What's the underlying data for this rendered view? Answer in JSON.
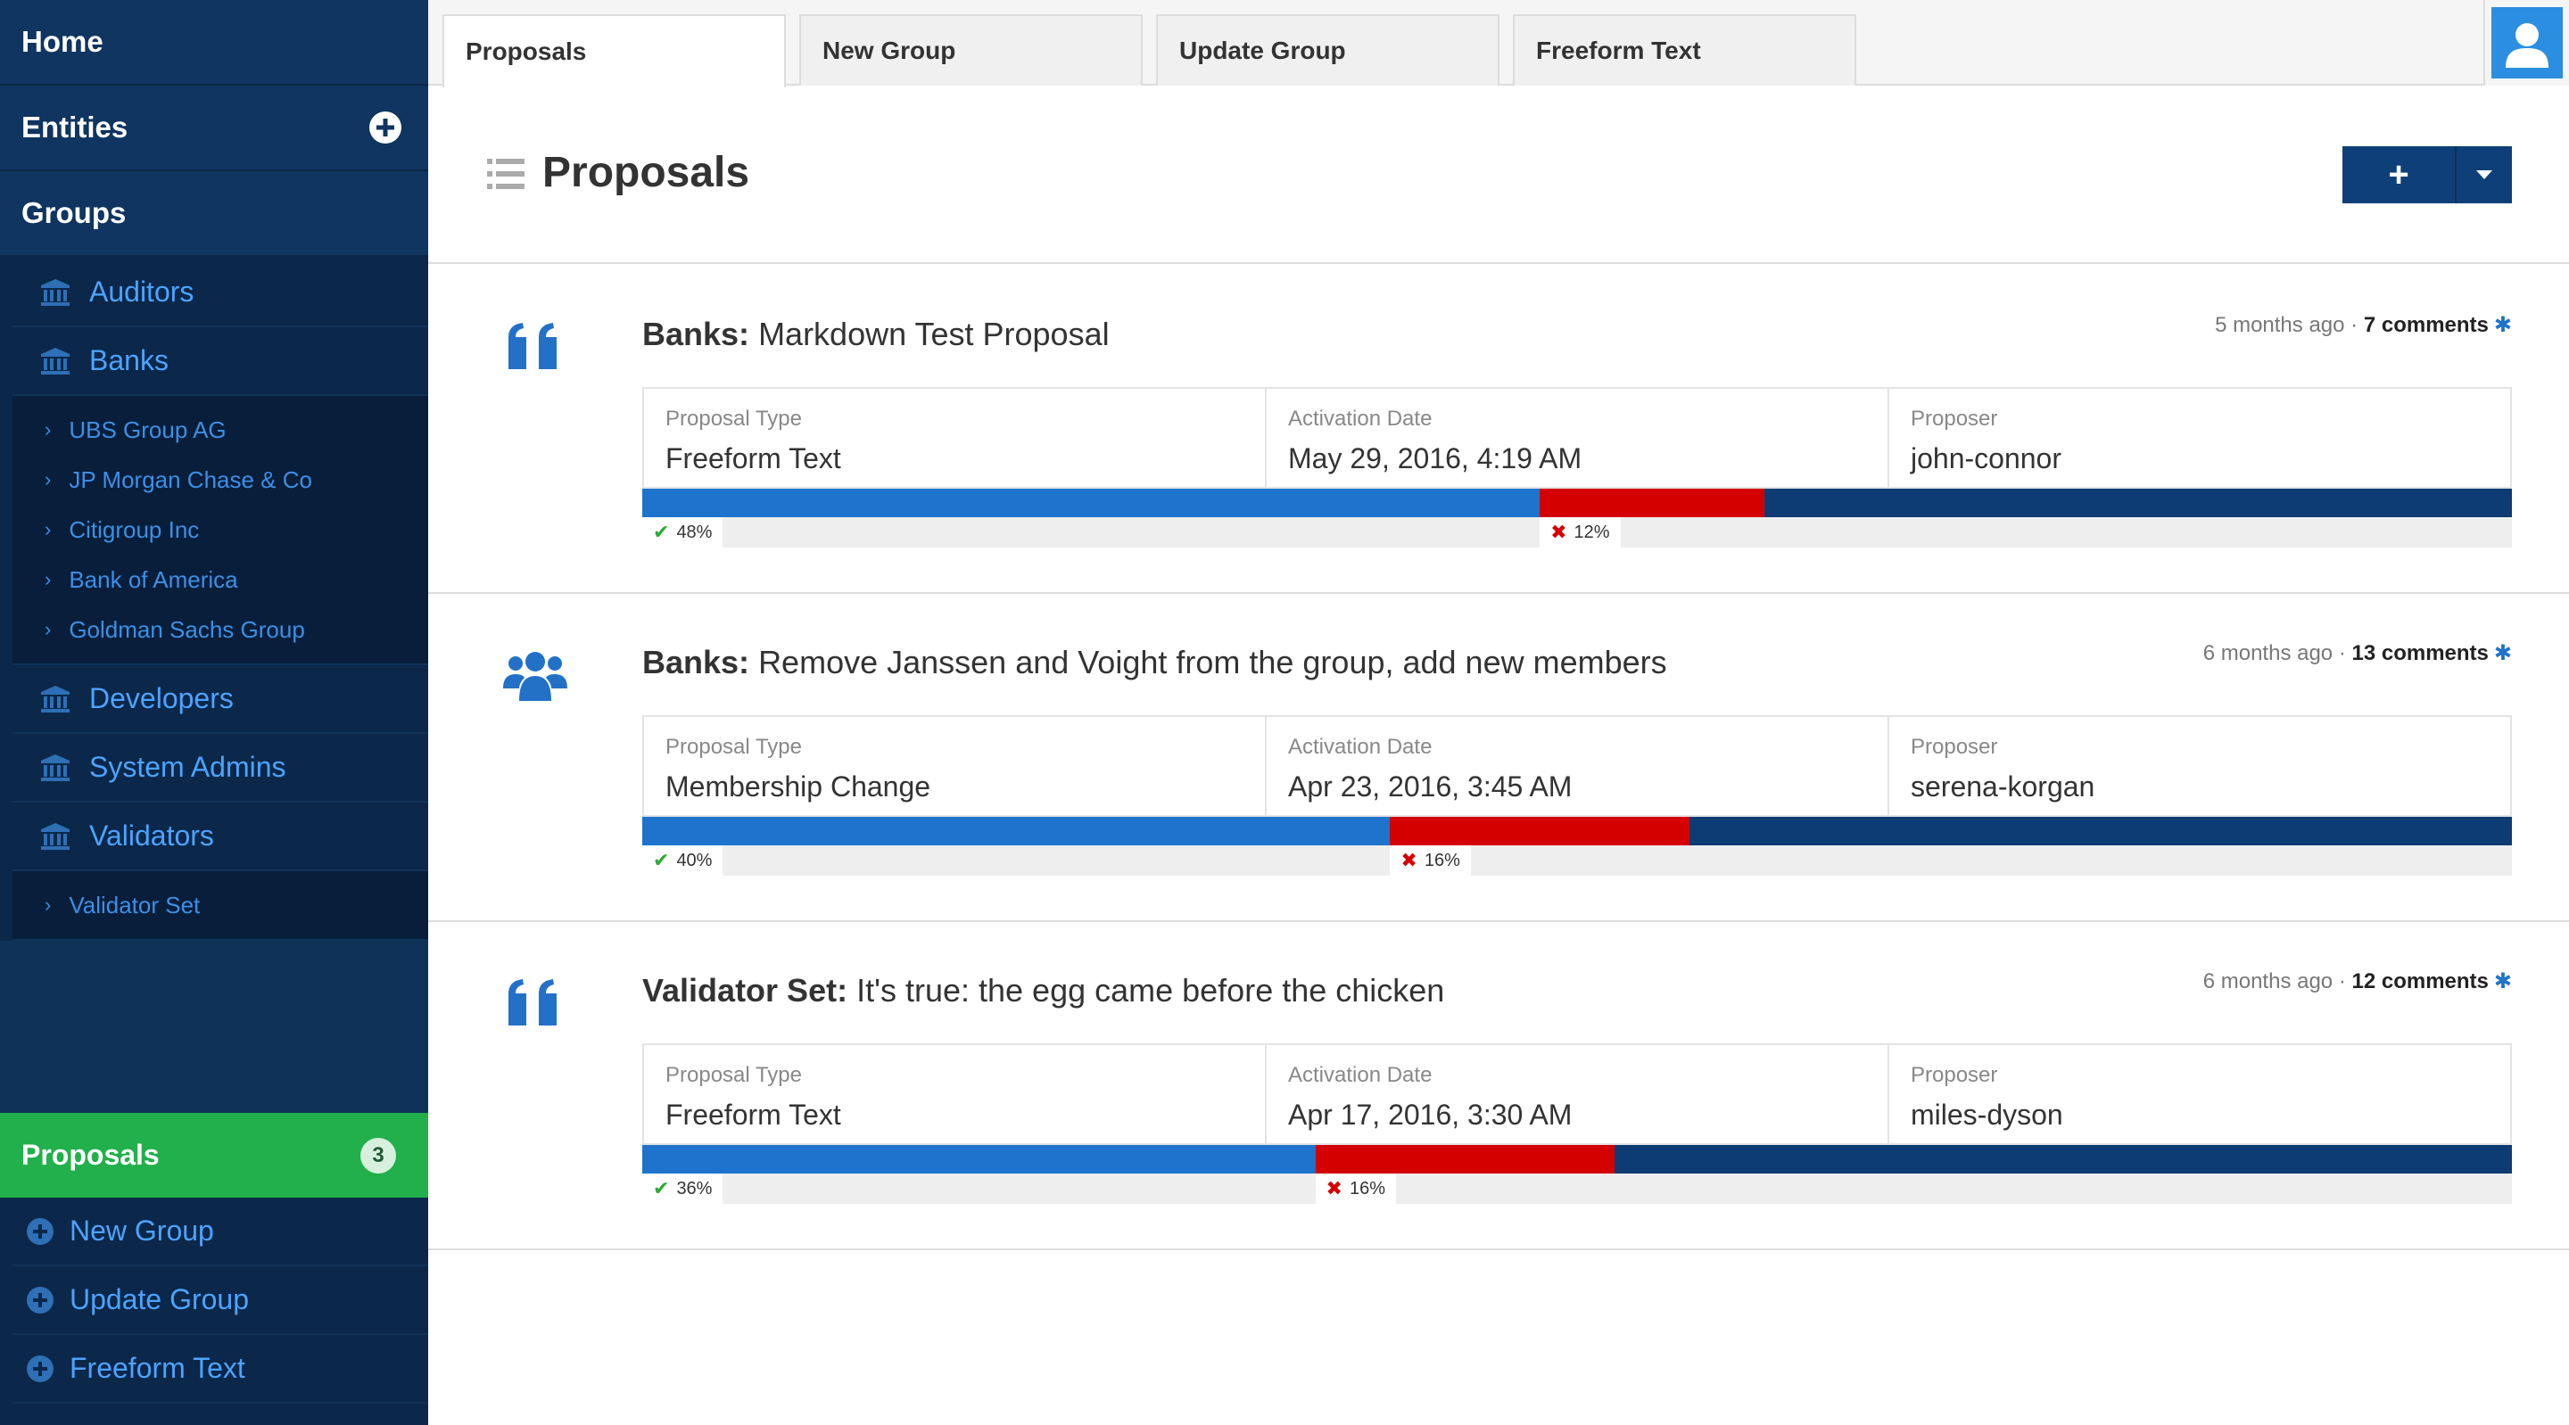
{
  "sidebar": {
    "home": "Home",
    "entities": "Entities",
    "groups": "Groups",
    "group_items": [
      {
        "label": "Auditors"
      },
      {
        "label": "Banks"
      },
      {
        "label": "Developers"
      },
      {
        "label": "System Admins"
      },
      {
        "label": "Validators"
      }
    ],
    "bank_subitems": [
      "UBS Group AG",
      "JP Morgan Chase & Co",
      "Citigroup Inc",
      "Bank of America",
      "Goldman Sachs Group"
    ],
    "validator_subitems": [
      "Validator Set"
    ],
    "proposals": {
      "label": "Proposals",
      "count": "3"
    },
    "proposal_subitems": [
      "New Group",
      "Update Group",
      "Freeform Text"
    ]
  },
  "tabs": [
    "Proposals",
    "New Group",
    "Update Group",
    "Freeform Text"
  ],
  "page": {
    "title": "Proposals",
    "add_label": "+"
  },
  "labels": {
    "type": "Proposal Type",
    "date": "Activation Date",
    "proposer": "Proposer"
  },
  "proposals": [
    {
      "icon": "quote-icon",
      "group": "Banks:",
      "title": "Markdown Test Proposal",
      "age": "5 months ago",
      "comments": "7 comments",
      "type": "Freeform Text",
      "date": "May 29, 2016, 4:19 AM",
      "proposer": "john-connor",
      "yes_pct": 48,
      "no_pct": 12,
      "yes_label": "48%",
      "no_label": "12%"
    },
    {
      "icon": "users-icon",
      "group": "Banks:",
      "title": "Remove Janssen and Voight from the group, add new members",
      "age": "6 months ago",
      "comments": "13 comments",
      "type": "Membership Change",
      "date": "Apr 23, 2016, 3:45 AM",
      "proposer": "serena-korgan",
      "yes_pct": 40,
      "no_pct": 16,
      "yes_label": "40%",
      "no_label": "16%"
    },
    {
      "icon": "quote-icon",
      "group": "Validator Set:",
      "title": "It's true: the egg came before the chicken",
      "age": "6 months ago",
      "comments": "12 comments",
      "type": "Freeform Text",
      "date": "Apr 17, 2016, 3:30 AM",
      "proposer": "miles-dyson",
      "yes_pct": 36,
      "no_pct": 16,
      "yes_label": "36%",
      "no_label": "16%"
    }
  ],
  "colors": {
    "sidebar": "#0f3258",
    "accent_green": "#21b04b",
    "yes": "#1e73cc",
    "no": "#d40000",
    "remaining": "#0d3c74"
  }
}
